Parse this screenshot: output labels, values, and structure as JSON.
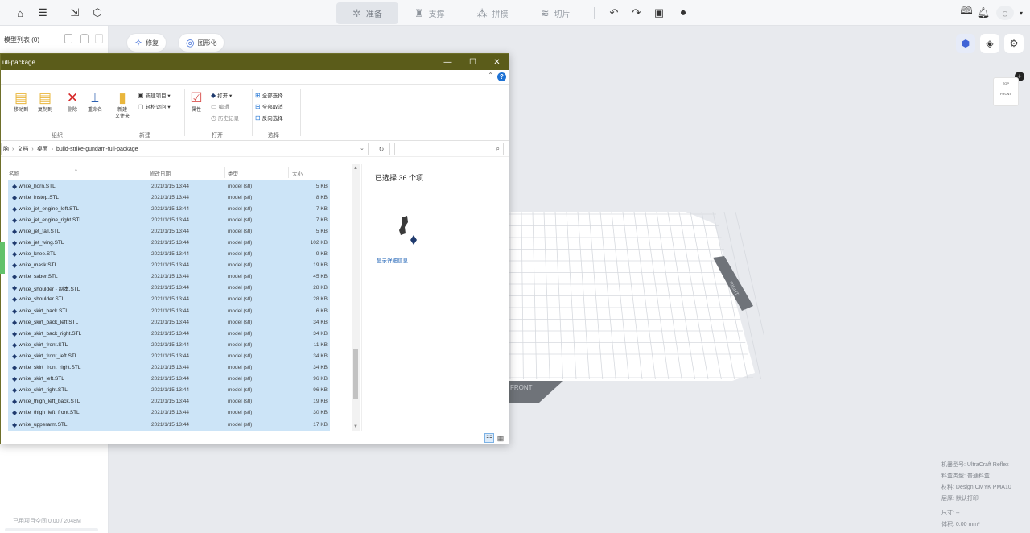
{
  "slicer": {
    "tabs": [
      {
        "label": "准备",
        "icon": "prepare-icon"
      },
      {
        "label": "支撑",
        "icon": "support-icon"
      },
      {
        "label": "拼模",
        "icon": "assemble-icon"
      },
      {
        "label": "切片",
        "icon": "slice-icon"
      }
    ],
    "left_panel": {
      "title": "模型列表 (0)",
      "storage": "已用项目空间 0.00 / 2048M"
    },
    "toolbar_pills": [
      {
        "label": "修复",
        "icon": "repair-icon"
      },
      {
        "label": "图形化",
        "icon": "graph-icon"
      }
    ],
    "cube_labels": {
      "top": "TOP",
      "front": "FRONT"
    },
    "plate_labels": {
      "side": "RIGHT",
      "front": "FRONT"
    },
    "machine_info": [
      "机器型号: UltraCraft Reflex",
      "料盒类型: 普通料盒",
      "材料: Design CMYK PMA10",
      "层厚: 默认打印",
      "尺寸: --",
      "体积: 0.00 mm³"
    ]
  },
  "explorer": {
    "title": "ull-package",
    "ribbon": {
      "groups": [
        {
          "label": "组织"
        },
        {
          "label": "新建"
        },
        {
          "label": "打开"
        },
        {
          "label": "选择"
        }
      ],
      "organize": [
        "移动到",
        "复制到",
        "删除",
        "重命名"
      ],
      "new_folder": "新建\n文件夹",
      "new_item": "新建项目 ▾",
      "easy_access": "轻松访问 ▾",
      "properties": "属性",
      "open": "打开 ▾",
      "edit": "编辑",
      "history": "历史记录",
      "select_all": "全部选择",
      "select_none": "全部取消",
      "invert_select": "反向选择"
    },
    "breadcrumb": [
      "脑",
      "文档",
      "桌面",
      "build-strike-gundam-full-package"
    ],
    "columns": {
      "name": "名称",
      "date": "修改日期",
      "type": "类型",
      "size": "大小"
    },
    "files": [
      {
        "name": "white_horn.STL",
        "date": "2021/1/15 13:44",
        "type": "model (stl)",
        "size": "5 KB"
      },
      {
        "name": "white_instep.STL",
        "date": "2021/1/15 13:44",
        "type": "model (stl)",
        "size": "8 KB"
      },
      {
        "name": "white_jet_engine_left.STL",
        "date": "2021/1/15 13:44",
        "type": "model (stl)",
        "size": "7 KB"
      },
      {
        "name": "white_jet_engine_right.STL",
        "date": "2021/1/15 13:44",
        "type": "model (stl)",
        "size": "7 KB"
      },
      {
        "name": "white_jet_tail.STL",
        "date": "2021/1/15 13:44",
        "type": "model (stl)",
        "size": "5 KB"
      },
      {
        "name": "white_jet_wing.STL",
        "date": "2021/1/15 13:44",
        "type": "model (stl)",
        "size": "102 KB"
      },
      {
        "name": "white_knee.STL",
        "date": "2021/1/15 13:44",
        "type": "model (stl)",
        "size": "9 KB"
      },
      {
        "name": "white_mask.STL",
        "date": "2021/1/15 13:44",
        "type": "model (stl)",
        "size": "19 KB"
      },
      {
        "name": "white_saber.STL",
        "date": "2021/1/15 13:44",
        "type": "model (stl)",
        "size": "45 KB"
      },
      {
        "name": "white_shoulder - 副本.STL",
        "date": "2021/1/15 13:44",
        "type": "model (stl)",
        "size": "28 KB"
      },
      {
        "name": "white_shoulder.STL",
        "date": "2021/1/15 13:44",
        "type": "model (stl)",
        "size": "28 KB"
      },
      {
        "name": "white_skirt_back.STL",
        "date": "2021/1/15 13:44",
        "type": "model (stl)",
        "size": "6 KB"
      },
      {
        "name": "white_skirt_back_left.STL",
        "date": "2021/1/15 13:44",
        "type": "model (stl)",
        "size": "34 KB"
      },
      {
        "name": "white_skirt_back_right.STL",
        "date": "2021/1/15 13:44",
        "type": "model (stl)",
        "size": "34 KB"
      },
      {
        "name": "white_skirt_front.STL",
        "date": "2021/1/15 13:44",
        "type": "model (stl)",
        "size": "11 KB"
      },
      {
        "name": "white_skirt_front_left.STL",
        "date": "2021/1/15 13:44",
        "type": "model (stl)",
        "size": "34 KB"
      },
      {
        "name": "white_skirt_front_right.STL",
        "date": "2021/1/15 13:44",
        "type": "model (stl)",
        "size": "34 KB"
      },
      {
        "name": "white_skirt_left.STL",
        "date": "2021/1/15 13:44",
        "type": "model (stl)",
        "size": "96 KB"
      },
      {
        "name": "white_skirt_right.STL",
        "date": "2021/1/15 13:44",
        "type": "model (stl)",
        "size": "96 KB"
      },
      {
        "name": "white_thigh_left_back.STL",
        "date": "2021/1/15 13:44",
        "type": "model (stl)",
        "size": "19 KB"
      },
      {
        "name": "white_thigh_left_front.STL",
        "date": "2021/1/15 13:44",
        "type": "model (stl)",
        "size": "30 KB"
      },
      {
        "name": "white_upperarm.STL",
        "date": "2021/1/15 13:44",
        "type": "model (stl)",
        "size": "17 KB"
      }
    ],
    "selected_count": "已选择 36 个项",
    "details_link": "显示详细信息...",
    "colors": {
      "title_bg": "#5b5c1a",
      "selection": "#cce4f7"
    }
  }
}
